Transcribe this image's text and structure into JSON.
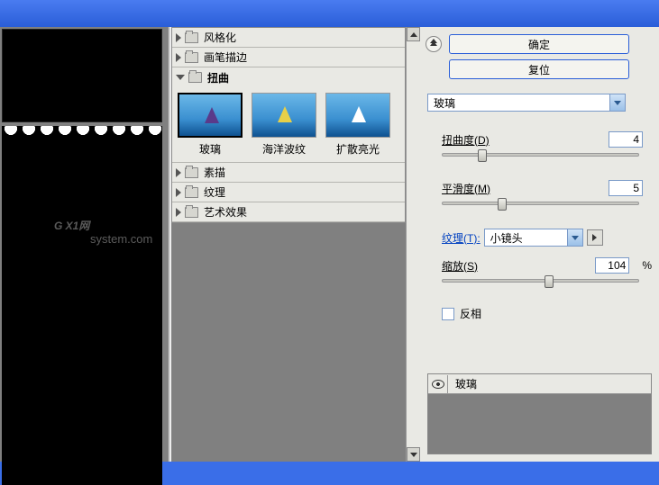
{
  "titlebar": "",
  "buttons": {
    "ok": "确定",
    "reset": "复位"
  },
  "tree": {
    "items": [
      {
        "label": "风格化"
      },
      {
        "label": "画笔描边"
      },
      {
        "label": "扭曲",
        "expanded": true
      },
      {
        "label": "素描"
      },
      {
        "label": "纹理"
      },
      {
        "label": "艺术效果"
      }
    ]
  },
  "thumbs": [
    {
      "label": "玻璃"
    },
    {
      "label": "海洋波纹"
    },
    {
      "label": "扩散亮光"
    }
  ],
  "filter_select": "玻璃",
  "params": {
    "distortion": {
      "label": "扭曲度(D)",
      "value": "4"
    },
    "smoothness": {
      "label": "平滑度(M)",
      "value": "5"
    },
    "texture": {
      "label": "纹理(T):",
      "value": "小镜头"
    },
    "scale": {
      "label": "缩放(S)",
      "value": "104",
      "unit": "%"
    },
    "invert": {
      "label": "反相"
    }
  },
  "layers": {
    "name": "玻璃"
  },
  "watermark": {
    "main": "G X1网",
    "sub": "system.com"
  }
}
